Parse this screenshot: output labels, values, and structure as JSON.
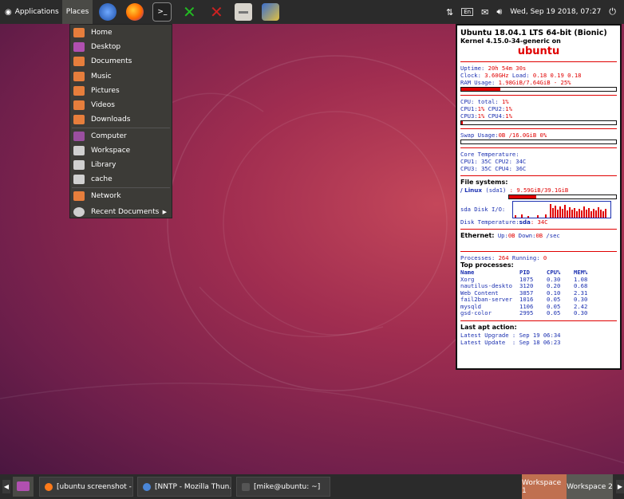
{
  "top_panel": {
    "applications": "Applications",
    "places": "Places",
    "launchers": [
      "thunderbird-icon",
      "firefox-icon",
      "terminal-icon",
      "green-x-icon",
      "red-x-icon",
      "file-manager-icon",
      "network-icon"
    ],
    "tray": {
      "lang": "En",
      "datetime": "Wed, Sep 19 2018, 07:27"
    }
  },
  "places_menu": {
    "items": [
      "Home",
      "Desktop",
      "Documents",
      "Music",
      "Pictures",
      "Videos",
      "Downloads",
      "Computer",
      "Workspace",
      "Library",
      "cache",
      "Network",
      "Recent Documents"
    ]
  },
  "conky": {
    "title": "Ubuntu 18.04.1 LTS 64-bit (Bionic)",
    "kernel": "Kernel 4.15.0-34-generic on",
    "host": "ubuntu",
    "uptime_label": "Uptime: ",
    "uptime": "20h 54m 30s",
    "clock_label": "Clock: ",
    "clock": "3.60GHz",
    "load_label": "  Load: ",
    "load": "0.18 0.19 0.18",
    "ram_label": "RAM Usage: ",
    "ram": "1.98GiB/7.64GiB - 25%",
    "ram_pct": 25,
    "cpu_total_label": "CPU: total: ",
    "cpu_total": "1%",
    "cpu1_label": "CPU1:",
    "cpu1": "1%",
    "cpu2_label": " CPU2:",
    "cpu2": "1%",
    "cpu3_label": "CPU3:",
    "cpu3": "1%",
    "cpu4_label": " CPU4:",
    "cpu4": "1%",
    "cpu_pct": 1,
    "swap_label": "Swap Usage:",
    "swap": "0B  /16.0GiB 0%",
    "swap_pct": 0,
    "core_temp_label": "Core Temperature:",
    "core_temp_1": "CPU1: 35C  CPU2: 34C",
    "core_temp_2": "CPU3: 35C CPU4: 36C",
    "fs_header": "File systems:",
    "fs_name": "/ Linux",
    "fs_dev": " (sda1)",
    "fs_usage": "  : 9.59GiB/39.1GiB",
    "fs_pct": 25,
    "disk_io_label": "sda Disk I/O:",
    "disk_temp_label": "Disk Temperature:",
    "disk_temp_dev": "sda",
    "disk_temp": ": 34C",
    "eth_label": "Ethernet:",
    "eth_up_label": " Up:",
    "eth_up": "0B",
    "eth_down_label": "   Down:",
    "eth_down": "0B",
    "eth_unit": "  /sec",
    "processes_label": "Processes: ",
    "processes": "264",
    "running_label": "  Running: ",
    "running": "0",
    "top_header": "Top processes:",
    "top_columns": [
      "Name",
      "PID",
      "CPU%",
      "MEM%"
    ],
    "top_rows": [
      [
        "Xorg",
        "1075",
        "0.30",
        "1.08"
      ],
      [
        "nautilus-deskto",
        "3120",
        "0.20",
        "0.68"
      ],
      [
        "Web Content",
        "3857",
        "0.10",
        "2.31"
      ],
      [
        "fail2ban-server",
        "1016",
        "0.05",
        "0.30"
      ],
      [
        "mysqld",
        "1106",
        "0.05",
        "2.42"
      ],
      [
        "gsd-color",
        "2995",
        "0.05",
        "0.30"
      ]
    ],
    "apt_header": "Last apt action:",
    "apt_upgrade": "Latest Upgrade : Sep 19 06:34",
    "apt_update": "Latest Update  : Sep 18 06:23"
  },
  "bottom_panel": {
    "tasks": [
      {
        "label": "[ubuntu screenshot - ...",
        "icon": "firefox-icon"
      },
      {
        "label": "[NNTP - Mozilla Thun...",
        "icon": "thunderbird-icon"
      },
      {
        "label": "[mike@ubuntu: ~]",
        "icon": "terminal-icon"
      }
    ],
    "workspaces": [
      "Workspace 1",
      "Workspace 2"
    ]
  },
  "colors": {
    "accent": "#e00000",
    "conky_text_blue": "#1a2fb0",
    "panel": "#2b2b2b",
    "workspace_active": "#c07050"
  }
}
